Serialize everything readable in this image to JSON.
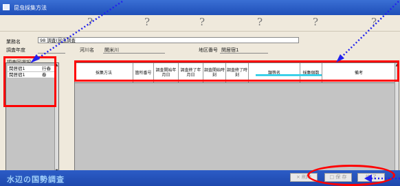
{
  "window": {
    "title": "昆虫採集方法"
  },
  "deco_marks": [
    "?",
    "?",
    "?",
    "?",
    "?",
    "?"
  ],
  "form": {
    "business_name_label": "業務名",
    "business_name_value": "98 調査(昆虫調査",
    "survey_year_label": "調査年度",
    "river_name_label": "河川名",
    "river_name_value": "関米川",
    "area_no_label": "地区番号",
    "area_no_value": "関居宿1"
  },
  "survey_round": {
    "label": "調査回選択",
    "rows": [
      {
        "name": "関居宿1",
        "status": "行春"
      },
      {
        "name": "関居宿1",
        "status": "春"
      }
    ]
  },
  "grid": {
    "columns": [
      "採集方法",
      "箇所番号",
      "調査開始年月日",
      "調査終了年月日",
      "調査開始時刻",
      "調査終了時刻",
      "類等名",
      "採集個数",
      "備考"
    ]
  },
  "footer": {
    "brand": "水辺の国勢調査",
    "buttons": [
      "× 削除",
      "□ 保 存",
      "終 了"
    ]
  },
  "colors": {
    "annotation_red": "#ff0000",
    "annotation_blue": "#2222ee",
    "highlight_cyan": "#3dd0e8"
  }
}
